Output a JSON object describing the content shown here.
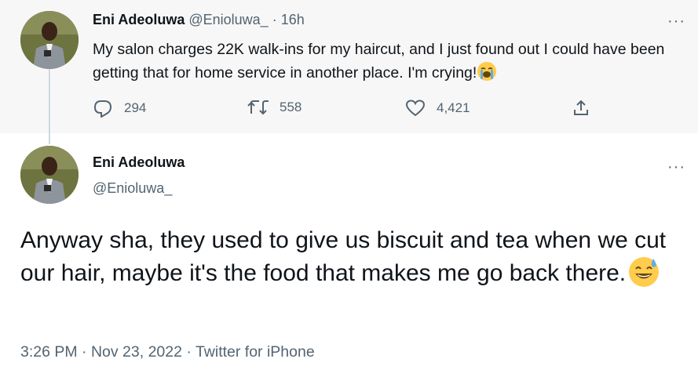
{
  "reply_tweet": {
    "author_name": "Eni Adeoluwa",
    "handle": "@Enioluwa_",
    "separator": "·",
    "time": "16h",
    "text": "My salon charges 22K walk-ins for my haircut, and I just found out I could have been getting that for home service in another place. I'm crying!",
    "emoji": "loudly-crying-face",
    "reply_count": "294",
    "retweet_count": "558",
    "like_count": "4,421"
  },
  "main_tweet": {
    "author_name": "Eni Adeoluwa",
    "handle": "@Enioluwa_",
    "text": "Anyway sha, they used to give us biscuit and tea when we cut our hair, maybe it's the food that makes me go back there.",
    "emoji": "grinning-face-with-sweat",
    "timestamp": "3:26 PM · Nov 23, 2022 · ",
    "source": "Twitter for iPhone"
  },
  "more_label": "···",
  "colors": {
    "text": "#0f1419",
    "secondary": "#536471",
    "thread_line": "#cfd9de",
    "reply_bg": "#f7f7f7"
  }
}
